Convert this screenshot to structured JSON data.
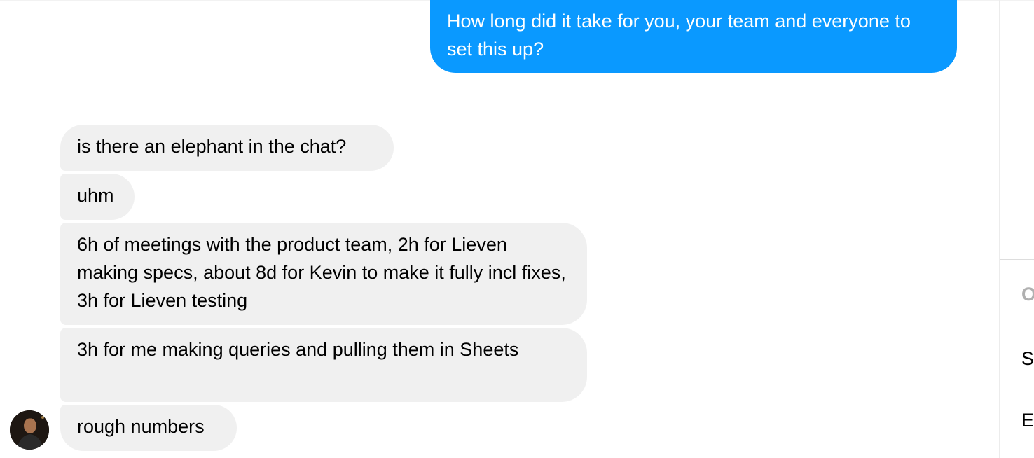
{
  "conversation": {
    "outgoing": [
      {
        "text": "How long did it take for you, your team and everyone to set this up?"
      }
    ],
    "incoming": [
      {
        "text": "is there an elephant in the chat?"
      },
      {
        "text": "uhm"
      },
      {
        "text": "6h of meetings with the product team, 2h for Lieven making specs, about 8d for Kevin to make it fully incl fixes, 3h for Lieven testing"
      },
      {
        "text": "3h for me making queries and pulling them in Sheets"
      },
      {
        "text": "rough numbers"
      }
    ]
  },
  "side_panel": {
    "items": [
      "O",
      "S",
      "E"
    ]
  },
  "colors": {
    "outgoing_bubble": "#0a99ff",
    "incoming_bubble": "#f0f0f0"
  }
}
